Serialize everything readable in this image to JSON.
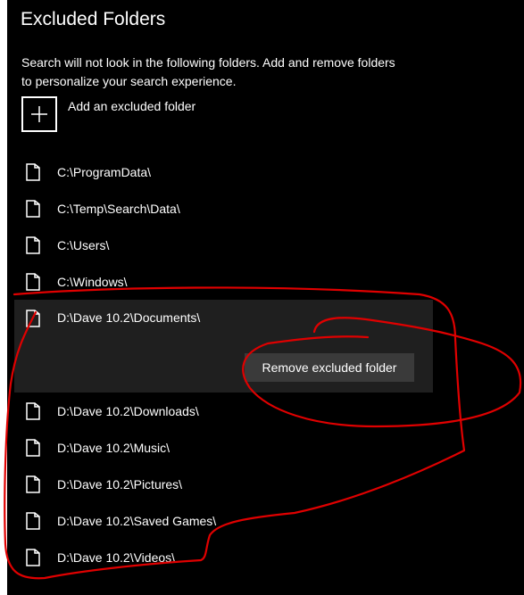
{
  "header": {
    "title": "Excluded Folders",
    "description": "Search will not look in the following folders. Add and remove folders to personalize your search experience."
  },
  "add_folder": {
    "label": "Add an excluded folder",
    "icon": "plus-icon"
  },
  "folders": [
    {
      "path": "C:\\ProgramData\\",
      "icon": "folder-icon"
    },
    {
      "path": "C:\\Temp\\Search\\Data\\",
      "icon": "folder-icon"
    },
    {
      "path": "C:\\Users\\",
      "icon": "folder-icon"
    },
    {
      "path": "C:\\Windows\\",
      "icon": "folder-icon"
    },
    {
      "path": "D:\\Dave 10.2\\Documents\\",
      "icon": "folder-icon",
      "selected": true
    },
    {
      "path": "D:\\Dave 10.2\\Downloads\\",
      "icon": "folder-icon"
    },
    {
      "path": "D:\\Dave 10.2\\Music\\",
      "icon": "folder-icon"
    },
    {
      "path": "D:\\Dave 10.2\\Pictures\\",
      "icon": "folder-icon"
    },
    {
      "path": "D:\\Dave 10.2\\Saved Games\\",
      "icon": "folder-icon"
    },
    {
      "path": "D:\\Dave 10.2\\Videos\\",
      "icon": "folder-icon"
    }
  ],
  "selected_actions": {
    "remove_label": "Remove excluded folder"
  },
  "colors": {
    "background": "#000000",
    "selected_row": "#1f1f1f",
    "button": "#3a3a3a",
    "text": "#ffffff",
    "annotation": "#e00000"
  }
}
